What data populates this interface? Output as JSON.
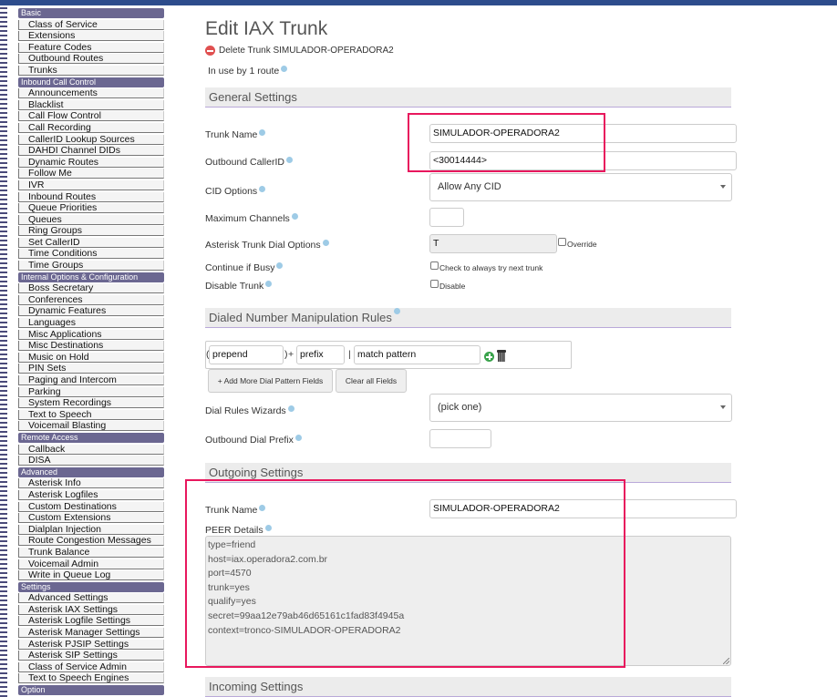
{
  "sidebar": {
    "groups": [
      {
        "head": "Basic",
        "items": [
          "Class of Service",
          "Extensions",
          "Feature Codes",
          "Outbound Routes",
          "Trunks"
        ]
      },
      {
        "head": "Inbound Call Control",
        "items": [
          "Announcements",
          "Blacklist",
          "Call Flow Control",
          "Call Recording",
          "CallerID Lookup Sources",
          "DAHDI Channel DIDs",
          "Dynamic Routes",
          "Follow Me",
          "IVR",
          "Inbound Routes",
          "Queue Priorities",
          "Queues",
          "Ring Groups",
          "Set CallerID",
          "Time Conditions",
          "Time Groups"
        ]
      },
      {
        "head": "Internal Options & Configuration",
        "items": [
          "Boss Secretary",
          "Conferences",
          "Dynamic Features",
          "Languages",
          "Misc Applications",
          "Misc Destinations",
          "Music on Hold",
          "PIN Sets",
          "Paging and Intercom",
          "Parking",
          "System Recordings",
          "Text to Speech",
          "Voicemail Blasting"
        ]
      },
      {
        "head": "Remote Access",
        "items": [
          "Callback",
          "DISA"
        ]
      },
      {
        "head": "Advanced",
        "items": [
          "Asterisk Info",
          "Asterisk Logfiles",
          "Custom Destinations",
          "Custom Extensions",
          "Dialplan Injection",
          "Route Congestion Messages",
          "Trunk Balance",
          "Voicemail Admin",
          "Write in Queue Log"
        ]
      },
      {
        "head": "Settings",
        "items": [
          "Advanced Settings",
          "Asterisk IAX Settings",
          "Asterisk Logfile Settings",
          "Asterisk Manager Settings",
          "Asterisk PJSIP Settings",
          "Asterisk SIP Settings",
          "Class of Service Admin",
          "Text to Speech Engines"
        ]
      },
      {
        "head": "Option",
        "items": []
      }
    ]
  },
  "page": {
    "title": "Edit IAX Trunk",
    "delete_label": "Delete Trunk SIMULADOR-OPERADORA2",
    "in_use": "In use by 1 route"
  },
  "general": {
    "section_title": "General Settings",
    "trunk_name_label": "Trunk Name",
    "trunk_name_value": "SIMULADOR-OPERADORA2",
    "outbound_callerid_label": "Outbound CallerID",
    "outbound_callerid_value": "<30014444>",
    "cid_options_label": "CID Options",
    "cid_options_value": "Allow Any CID",
    "max_channels_label": "Maximum Channels",
    "max_channels_value": "",
    "dial_options_label": "Asterisk Trunk Dial Options",
    "dial_options_value": "T",
    "override_label": "Override",
    "continue_busy_label": "Continue if Busy",
    "continue_busy_check_label": "Check to always try next trunk",
    "disable_trunk_label": "Disable Trunk",
    "disable_label": "Disable"
  },
  "dialed": {
    "section_title": "Dialed Number Manipulation Rules",
    "prepend_placeholder": "prepend",
    "prefix_placeholder": "prefix",
    "match_placeholder": "match pattern",
    "plus": "+",
    "open_paren": "(",
    "close_paren": ")",
    "pipe": "|",
    "add_more_label": "+ Add More Dial Pattern Fields",
    "clear_all_label": "Clear all Fields",
    "wizards_label": "Dial Rules Wizards",
    "wizards_value": "(pick one)",
    "outbound_prefix_label": "Outbound Dial Prefix",
    "outbound_prefix_value": ""
  },
  "outgoing": {
    "section_title": "Outgoing Settings",
    "trunk_name_label": "Trunk Name",
    "trunk_name_value": "SIMULADOR-OPERADORA2",
    "peer_details_label": "PEER Details",
    "peer_details": [
      "type=friend",
      "host=iax.operadora2.com.br",
      "port=4570",
      "trunk=yes",
      "qualify=yes",
      "secret=99aa12e79ab46d65161c1fad83f4945a",
      "context=tronco-SIMULADOR-OPERADORA2"
    ]
  },
  "incoming": {
    "section_title": "Incoming Settings"
  },
  "colors": {
    "highlight": "#e8175d",
    "menu_header": "#6b6791",
    "section_rule": "#b9a9d9",
    "topbar": "#2d4c8c"
  }
}
